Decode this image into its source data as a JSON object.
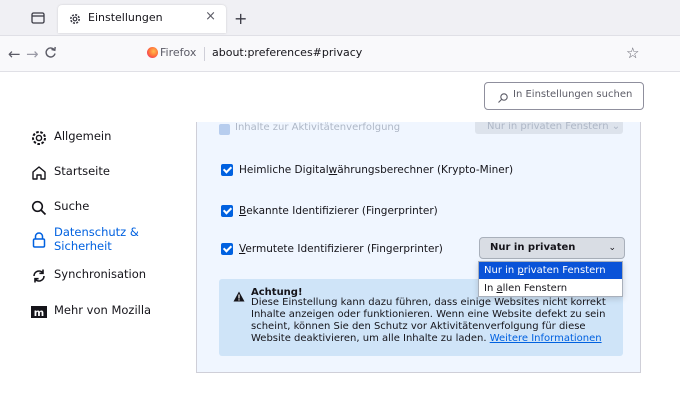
{
  "browser": {
    "tab_title": "Einstellungen",
    "tab_close": "×",
    "new_tab": "+",
    "identity_label": "Firefox",
    "url": "about:preferences#privacy"
  },
  "search": {
    "placeholder": "In Einstellungen suchen"
  },
  "sidebar": {
    "items": [
      {
        "label": "Allgemein",
        "icon": "gear-icon"
      },
      {
        "label": "Startseite",
        "icon": "home-icon"
      },
      {
        "label": "Suche",
        "icon": "search-icon"
      },
      {
        "label": "Datenschutz &\nSicherheit",
        "icon": "lock-icon",
        "active": true
      },
      {
        "label": "Synchronisation",
        "icon": "sync-icon"
      },
      {
        "label": "Mehr von Mozilla",
        "icon": "mozilla-icon"
      }
    ]
  },
  "panel": {
    "faded_row_label": "Inhalte zur Aktivitätenverfolgung",
    "faded_select_label": "Nur in privaten Fenstern ⌄",
    "checkboxes": [
      {
        "label_pre": "Heimliche Digital",
        "label_u": "w",
        "label_post": "ährungsberechner (Krypto-Miner)",
        "checked": true
      },
      {
        "label_pre": "",
        "label_u": "B",
        "label_post": "ekannte Identifizierer (Fingerprinter)",
        "checked": true
      },
      {
        "label_pre": "",
        "label_u": "V",
        "label_post": "ermutete Identifizierer (Fingerprinter)",
        "checked": true
      }
    ],
    "dropdown": {
      "selected": "Nur in privaten Fenstern",
      "options": [
        {
          "pre": "Nur in ",
          "u": "p",
          "post": "rivaten Fenstern"
        },
        {
          "pre": "In ",
          "u": "a",
          "post": "llen Fenstern"
        }
      ]
    },
    "warning": {
      "title": "Achtung!",
      "text": "Diese Einstellung kann dazu führen, dass einige Websites nicht korrekt Inhalte anzeigen oder funktionieren. Wenn eine Website defekt zu sein scheint, können Sie den Schutz vor Aktivitätenverfolgung für diese Website deaktivieren, um alle Inhalte zu laden.",
      "link": "Weitere Informationen"
    }
  },
  "colors": {
    "accent": "#0061e0",
    "selected_item": "#0a53d8",
    "panel_bg": "#f0f6ff",
    "warning_bg": "#cfe4f8"
  }
}
